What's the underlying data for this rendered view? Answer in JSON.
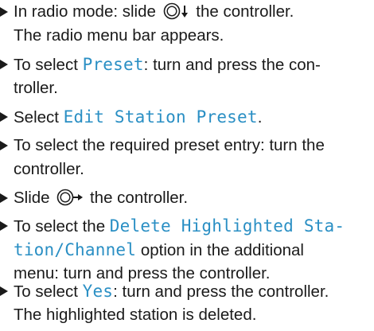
{
  "instructions": {
    "step1": {
      "a": "In radio mode: slide ",
      "controller_icon": "controller-slide-down-icon",
      "b": " the controller.",
      "line2": "The radio menu bar appears."
    },
    "step2": {
      "a": "To select ",
      "kw": "Preset",
      "b": ": turn and press the con-",
      "line2": "troller."
    },
    "step3": {
      "a": "Select ",
      "kw": "Edit Station Preset",
      "b": "."
    },
    "step4": {
      "line1": "To select the required preset entry: turn the",
      "line2": "controller."
    },
    "step5": {
      "a": "Slide ",
      "controller_icon": "controller-slide-right-icon",
      "b": " the controller."
    },
    "step6": {
      "a": "To select the ",
      "kw1": "Delete Highlighted Sta-",
      "kw2": "tion/Channel",
      "b": " option in the additional",
      "line3": "menu: turn and press the controller."
    },
    "step7": {
      "a": "To select ",
      "kw": "Yes",
      "b": ": turn and press the controller.",
      "line2": "The highlighted station is deleted."
    }
  },
  "colors": {
    "text": "#1a1a1a",
    "keyword": "#2a8fc4"
  }
}
